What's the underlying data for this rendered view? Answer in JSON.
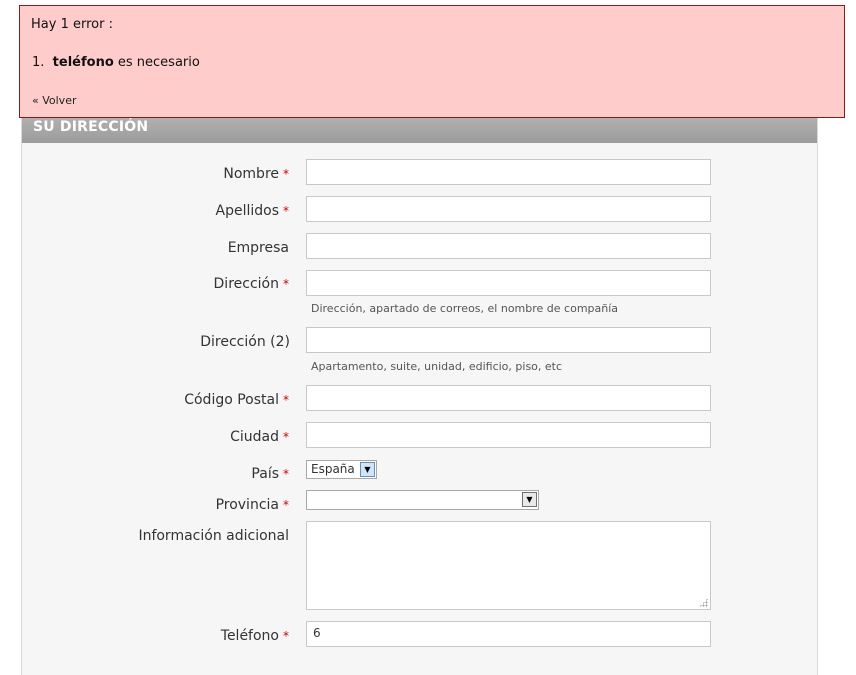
{
  "error": {
    "title": "Hay 1 error :",
    "items": [
      {
        "number": "1.",
        "field": "teléfono",
        "message": "es necesario"
      }
    ],
    "back_link": "« Volver"
  },
  "section": {
    "title": "SU DIRECCIÓN"
  },
  "form": {
    "required_marker": "*",
    "fields": {
      "nombre": {
        "label": "Nombre",
        "value": ""
      },
      "apellidos": {
        "label": "Apellidos",
        "value": ""
      },
      "empresa": {
        "label": "Empresa",
        "value": ""
      },
      "direccion": {
        "label": "Dirección",
        "value": "",
        "hint": "Dirección, apartado de correos, el nombre de compañía"
      },
      "direccion2": {
        "label": "Dirección (2)",
        "value": "",
        "hint": "Apartamento, suite, unidad, edificio, piso, etc"
      },
      "codigo_postal": {
        "label": "Código Postal",
        "value": ""
      },
      "ciudad": {
        "label": "Ciudad",
        "value": ""
      },
      "pais": {
        "label": "País",
        "value": "España"
      },
      "provincia": {
        "label": "Provincia",
        "value": ""
      },
      "informacion": {
        "label": "Información adicional",
        "value": ""
      },
      "telefono": {
        "label": "Teléfono",
        "value": "6"
      }
    }
  },
  "colors": {
    "error_bg": "#ffcccc",
    "error_border": "#8b1a1a",
    "header_bg": "#a6a6a6",
    "required": "#cc0000"
  }
}
